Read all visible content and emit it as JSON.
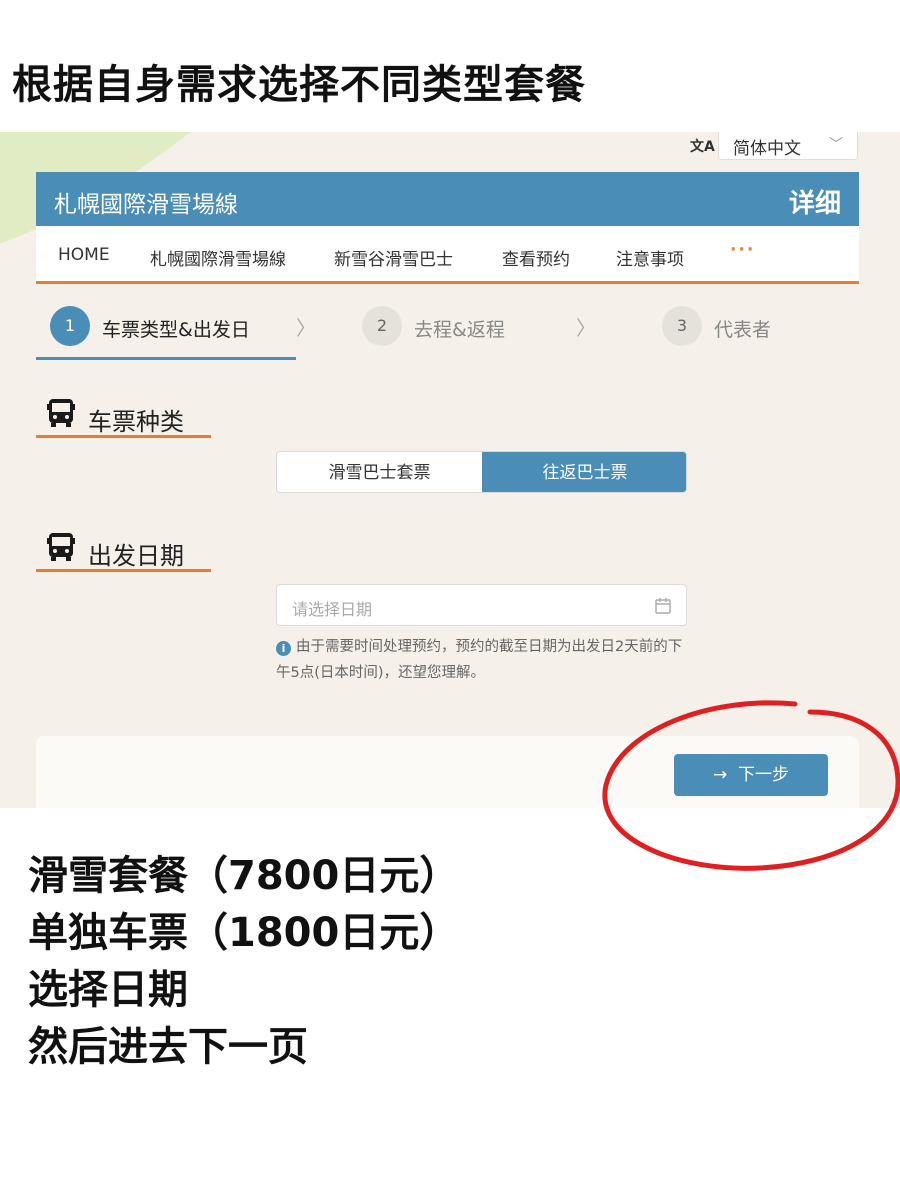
{
  "headline": "根据自身需求选择不同类型套餐",
  "language": {
    "label": "简体中文"
  },
  "banner": {
    "title": "札幌國際滑雪場線",
    "detail": "详细"
  },
  "nav": {
    "items": [
      "HOME",
      "札幌國際滑雪場線",
      "新雪谷滑雪巴士",
      "查看预约",
      "注意事项"
    ],
    "more": "···"
  },
  "steps": [
    {
      "num": "1",
      "label": "车票类型&出发日"
    },
    {
      "num": "2",
      "label": "去程&返程"
    },
    {
      "num": "3",
      "label": "代表者"
    }
  ],
  "ticket_section": {
    "title": "车票种类",
    "options": [
      "滑雪巴士套票",
      "往返巴士票"
    ],
    "selected": "往返巴士票"
  },
  "date_section": {
    "title": "出发日期",
    "placeholder": "请选择日期",
    "note": "由于需要时间处理预约，预约的截至日期为出发日2天前的下午5点(日本时间)，还望您理解。"
  },
  "next_button": {
    "arrow": "→",
    "label": "下一步"
  },
  "annotations": [
    "滑雪套餐（7800日元）",
    "单独车票（1800日元）",
    "选择日期",
    "然后进去下一页"
  ],
  "colors": {
    "accent_blue": "#4a8db6",
    "accent_orange": "#e67e2e",
    "annotation_red": "#e02020"
  }
}
